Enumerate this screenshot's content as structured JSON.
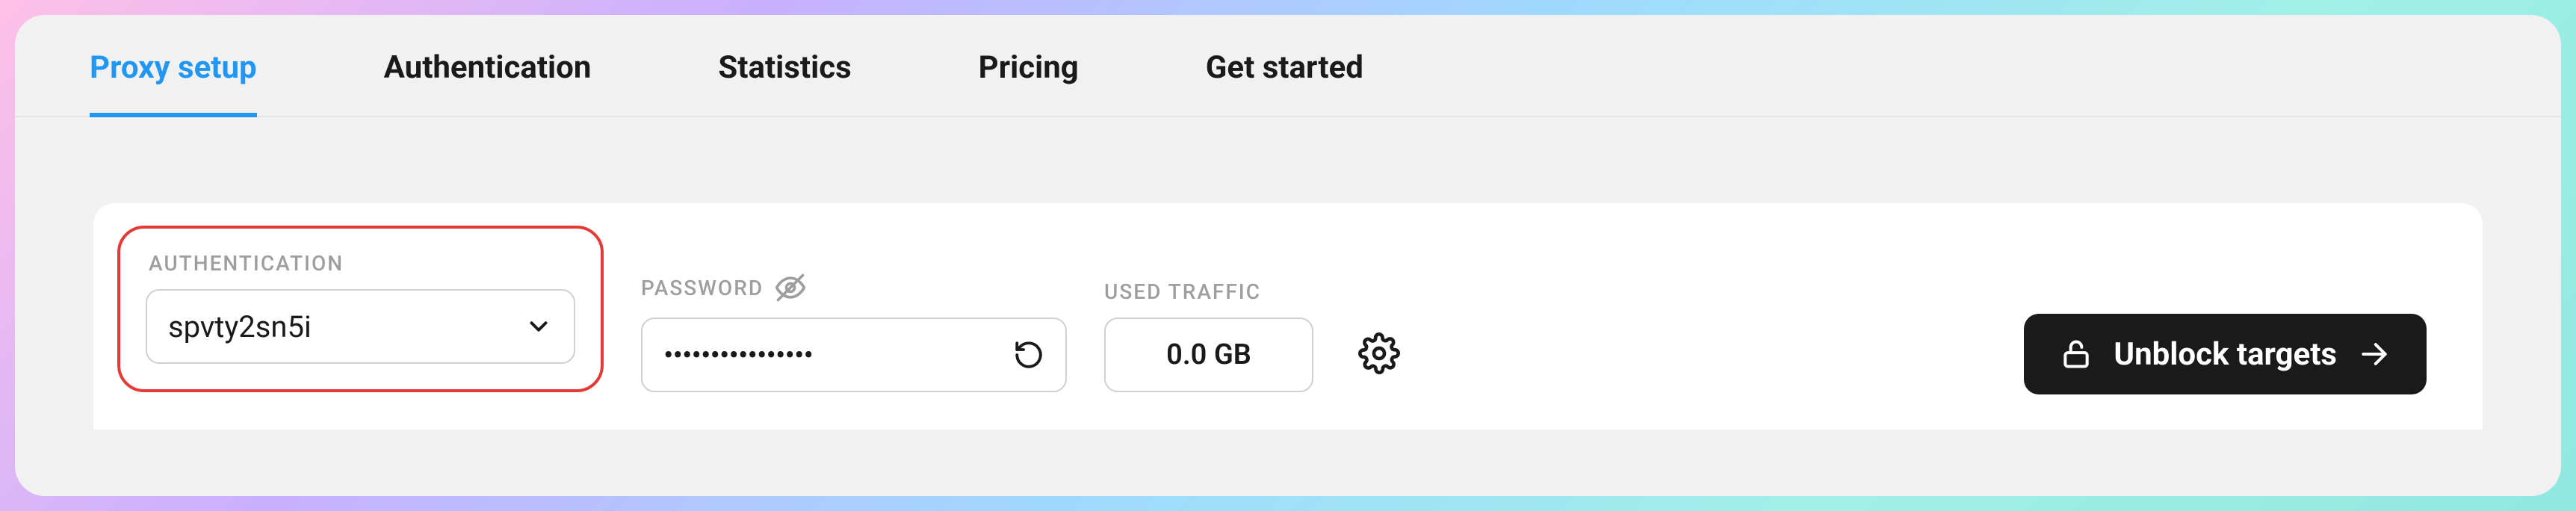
{
  "tabs": {
    "proxy_setup": "Proxy setup",
    "authentication": "Authentication",
    "statistics": "Statistics",
    "pricing": "Pricing",
    "get_started": "Get started",
    "active": "proxy_setup"
  },
  "fields": {
    "authentication": {
      "label": "AUTHENTICATION",
      "value": "spvty2sn5i"
    },
    "password": {
      "label": "PASSWORD",
      "value": "••••••••••••••••"
    },
    "used_traffic": {
      "label": "USED TRAFFIC",
      "value": "0.0 GB"
    }
  },
  "actions": {
    "unblock_targets": "Unblock targets"
  }
}
